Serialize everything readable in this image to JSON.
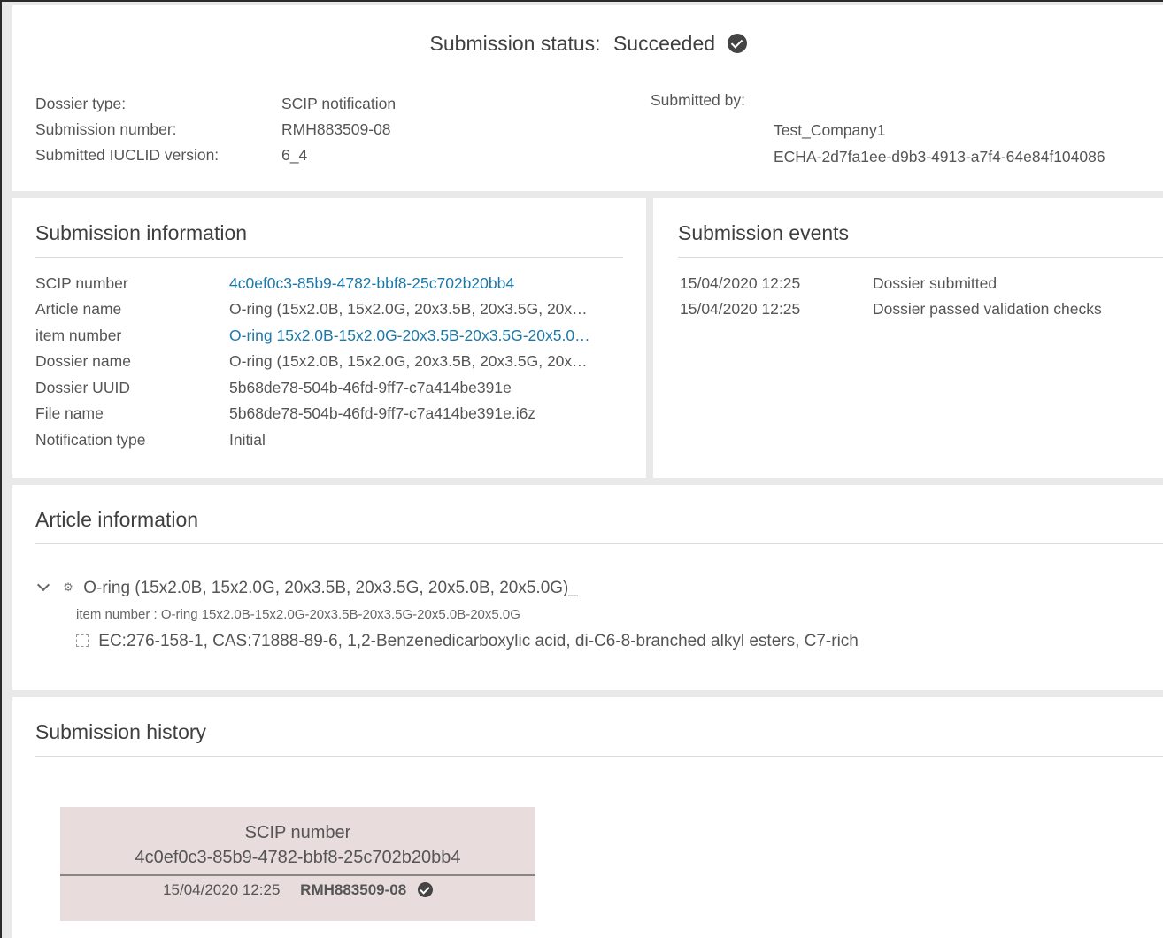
{
  "header": {
    "status_label": "Submission status:",
    "status_value": "Succeeded",
    "dossier_type_label": "Dossier type:",
    "dossier_type_value": "SCIP notification",
    "submission_number_label": "Submission number:",
    "submission_number_value": "RMH883509-08",
    "iuclid_label": "Submitted IUCLID version:",
    "iuclid_value": "6_4",
    "submitted_by_label": "Submitted by:",
    "company_name": "Test_Company1",
    "company_uuid": "ECHA-2d7fa1ee-d9b3-4913-a7f4-64e84f104086"
  },
  "info": {
    "title": "Submission information",
    "rows": [
      {
        "label": "SCIP number",
        "value": "4c0ef0c3-85b9-4782-bbf8-25c702b20bb4"
      },
      {
        "label": "Article name",
        "value": "O-ring (15x2.0B, 15x2.0G, 20x3.5B, 20x3.5G, 20x…"
      },
      {
        "label": "item number",
        "value": "O-ring 15x2.0B-15x2.0G-20x3.5B-20x3.5G-20x5.0…"
      },
      {
        "label": "Dossier name",
        "value": "O-ring (15x2.0B, 15x2.0G, 20x3.5B, 20x3.5G, 20x…"
      },
      {
        "label": "Dossier UUID",
        "value": "5b68de78-504b-46fd-9ff7-c7a414be391e"
      },
      {
        "label": "File name",
        "value": "5b68de78-504b-46fd-9ff7-c7a414be391e.i6z"
      },
      {
        "label": "Notification type",
        "value": "Initial"
      }
    ]
  },
  "events": {
    "title": "Submission events",
    "items": [
      {
        "date": "15/04/2020 12:25",
        "description": "Dossier submitted"
      },
      {
        "date": "15/04/2020 12:25",
        "description": "Dossier passed validation checks"
      }
    ]
  },
  "article": {
    "title": "Article information",
    "name": "O-ring (15x2.0B, 15x2.0G, 20x3.5B, 20x3.5G, 20x5.0B, 20x5.0G)_",
    "item_number": "item number : O-ring 15x2.0B-15x2.0G-20x3.5B-20x3.5G-20x5.0B-20x5.0G",
    "substance": "EC:276-158-1, CAS:71888-89-6, 1,2-Benzenedicarboxylic acid, di-C6-8-branched alkyl esters, C7-rich"
  },
  "history": {
    "title": "Submission history",
    "scip_label": "SCIP number",
    "scip_number": "4c0ef0c3-85b9-4782-bbf8-25c702b20bb4",
    "date": "15/04/2020 12:25",
    "submission_number": "RMH883509-08"
  },
  "icons": {
    "status": "check-circle-icon",
    "tree_toggle": "chevron-down-icon",
    "article": "gear-icon",
    "substance": "substance-icon"
  }
}
